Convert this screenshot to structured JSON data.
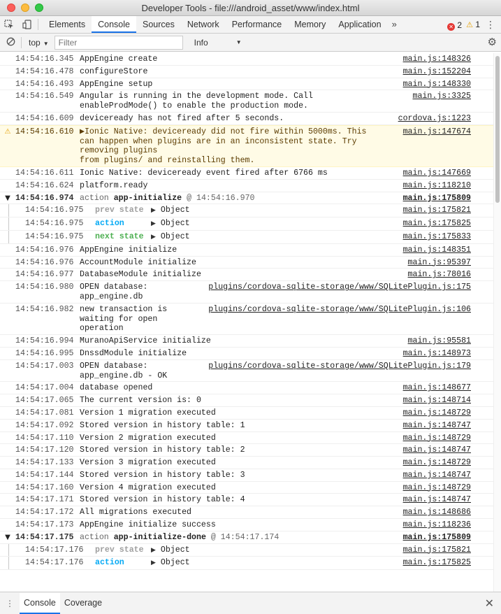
{
  "window": {
    "title": "Developer Tools - file:///android_asset/www/index.html"
  },
  "toolbar": {
    "inspect_icon": "inspect-element-icon",
    "device_icon": "device-toggle-icon",
    "tabs": [
      "Elements",
      "Console",
      "Sources",
      "Network",
      "Performance",
      "Memory",
      "Application"
    ],
    "active_tab": "Console",
    "more": "»",
    "error_count": "2",
    "warning_count": "1"
  },
  "filterbar": {
    "context": "top",
    "filter_placeholder": "Filter",
    "level": "Info"
  },
  "console": {
    "rows": [
      {
        "type": "log",
        "ts": "14:54:16.345",
        "msg": "AppEngine create",
        "src": "main.js:148326"
      },
      {
        "type": "log",
        "ts": "14:54:16.478",
        "msg": "configureStore",
        "src": "main.js:152204"
      },
      {
        "type": "log",
        "ts": "14:54:16.493",
        "msg": "AppEngine setup",
        "src": "main.js:148330"
      },
      {
        "type": "log",
        "ts": "14:54:16.549",
        "msg": "Angular is running in the development mode. Call\nenableProdMode() to enable the production mode.",
        "src": "main.js:3325"
      },
      {
        "type": "log",
        "ts": "14:54:16.609",
        "msg": "deviceready has not fired after 5 seconds.",
        "src": "cordova.js:1223"
      },
      {
        "type": "warning",
        "ts": "14:54:16.610",
        "msg": "▶Ionic Native: deviceready did not fire within 5000ms. This\ncan happen when plugins are in an inconsistent state. Try removing plugins\nfrom plugins/ and reinstalling them.",
        "src": "main.js:147674"
      },
      {
        "type": "log",
        "ts": "14:54:16.611",
        "msg": "Ionic Native: deviceready event fired after 6766 ms",
        "src": "main.js:147669"
      },
      {
        "type": "log",
        "ts": "14:54:16.624",
        "msg": "platform.ready",
        "src": "main.js:118210"
      },
      {
        "type": "group",
        "ts": "14:54:16.974",
        "label": "action",
        "action": "app-initialize",
        "at": "@ 14:54:16.970",
        "src": "main.js:175809"
      },
      {
        "type": "child",
        "ts": "14:54:16.975",
        "kind": "prev state",
        "kind_class": "prev",
        "obj": "Object",
        "src": "main.js:175821"
      },
      {
        "type": "child",
        "ts": "14:54:16.975",
        "kind": "action",
        "kind_class": "action",
        "obj": "Object",
        "src": "main.js:175825"
      },
      {
        "type": "child",
        "ts": "14:54:16.975",
        "kind": "next state",
        "kind_class": "next",
        "obj": "Object",
        "src": "main.js:175833"
      },
      {
        "type": "log",
        "ts": "14:54:16.976",
        "msg": "AppEngine initialize",
        "src": "main.js:148351"
      },
      {
        "type": "log",
        "ts": "14:54:16.976",
        "msg": "AccountModule initialize",
        "src": "main.js:95397"
      },
      {
        "type": "log",
        "ts": "14:54:16.977",
        "msg": "DatabaseModule initialize",
        "src": "main.js:78016"
      },
      {
        "type": "log",
        "ts": "14:54:16.980",
        "msg": "OPEN database:\napp_engine.db",
        "src": "plugins/cordova-sqlite-storage/www/SQLitePlugin.js:175"
      },
      {
        "type": "log",
        "ts": "14:54:16.982",
        "msg": "new transaction is\nwaiting for open operation",
        "src": "plugins/cordova-sqlite-storage/www/SQLitePlugin.js:106"
      },
      {
        "type": "log",
        "ts": "14:54:16.994",
        "msg": "MuranoApiService initialize",
        "src": "main.js:95581"
      },
      {
        "type": "log",
        "ts": "14:54:16.995",
        "msg": "DnssdModule initialize",
        "src": "main.js:148973"
      },
      {
        "type": "log",
        "ts": "14:54:17.003",
        "msg": "OPEN database:\napp_engine.db - OK",
        "src": "plugins/cordova-sqlite-storage/www/SQLitePlugin.js:179"
      },
      {
        "type": "log",
        "ts": "14:54:17.004",
        "msg": "database opened",
        "src": "main.js:148677"
      },
      {
        "type": "log",
        "ts": "14:54:17.065",
        "msg": "The current version is: 0",
        "src": "main.js:148714"
      },
      {
        "type": "log",
        "ts": "14:54:17.081",
        "msg": "Version 1 migration executed",
        "src": "main.js:148729"
      },
      {
        "type": "log",
        "ts": "14:54:17.092",
        "msg": "Stored version in history table: 1",
        "src": "main.js:148747"
      },
      {
        "type": "log",
        "ts": "14:54:17.110",
        "msg": "Version 2 migration executed",
        "src": "main.js:148729"
      },
      {
        "type": "log",
        "ts": "14:54:17.120",
        "msg": "Stored version in history table: 2",
        "src": "main.js:148747"
      },
      {
        "type": "log",
        "ts": "14:54:17.133",
        "msg": "Version 3 migration executed",
        "src": "main.js:148729"
      },
      {
        "type": "log",
        "ts": "14:54:17.144",
        "msg": "Stored version in history table: 3",
        "src": "main.js:148747"
      },
      {
        "type": "log",
        "ts": "14:54:17.160",
        "msg": "Version 4 migration executed",
        "src": "main.js:148729"
      },
      {
        "type": "log",
        "ts": "14:54:17.171",
        "msg": "Stored version in history table: 4",
        "src": "main.js:148747"
      },
      {
        "type": "log",
        "ts": "14:54:17.172",
        "msg": "All migrations executed",
        "src": "main.js:148686"
      },
      {
        "type": "log",
        "ts": "14:54:17.173",
        "msg": "AppEngine initialize success",
        "src": "main.js:118236"
      },
      {
        "type": "group",
        "ts": "14:54:17.175",
        "label": "action",
        "action": "app-initialize-done",
        "at": "@ 14:54:17.174",
        "src": "main.js:175809"
      },
      {
        "type": "child",
        "ts": "14:54:17.176",
        "kind": "prev state",
        "kind_class": "prev",
        "obj": "Object",
        "src": "main.js:175821"
      },
      {
        "type": "child",
        "ts": "14:54:17.176",
        "kind": "action",
        "kind_class": "action",
        "obj": "Object",
        "src": "main.js:175825"
      }
    ]
  },
  "drawer": {
    "tabs": [
      "Console",
      "Coverage"
    ],
    "active_tab": "Console"
  }
}
